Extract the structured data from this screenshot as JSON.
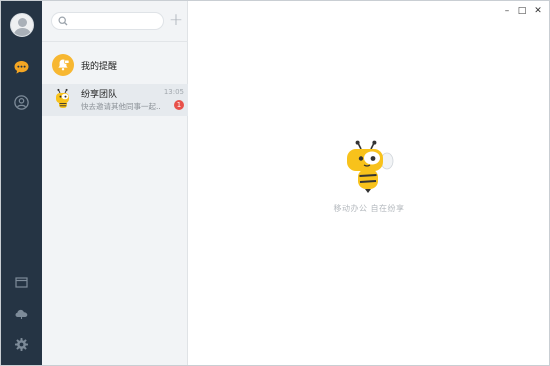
{
  "sidebar": {
    "items": [
      {
        "icon": "chat-bubble-icon",
        "active": true
      },
      {
        "icon": "contact-person-icon",
        "active": false
      },
      {
        "icon": "calendar-window-icon",
        "active": false
      },
      {
        "icon": "cloud-icon",
        "active": false
      },
      {
        "icon": "settings-gear-icon",
        "active": false
      }
    ],
    "accent_color": "#f5a623",
    "background": "#253444"
  },
  "search": {
    "placeholder": "",
    "value": ""
  },
  "toolbar": {
    "add_label": "+"
  },
  "sessions": [
    {
      "title": "我的提醒",
      "icon": "reminder-icon",
      "color": "#f7b731"
    },
    {
      "title": "纷享团队",
      "time": "13:05",
      "preview": "快去邀请其他同事一起...",
      "unread": "1",
      "icon": "bee-mascot-icon"
    }
  ],
  "window_controls": {
    "minimize": "–",
    "maximize": "□",
    "close": "✕"
  },
  "main": {
    "tagline": "移动办公 自在纷享",
    "mascot": "bee-mascot-icon"
  }
}
